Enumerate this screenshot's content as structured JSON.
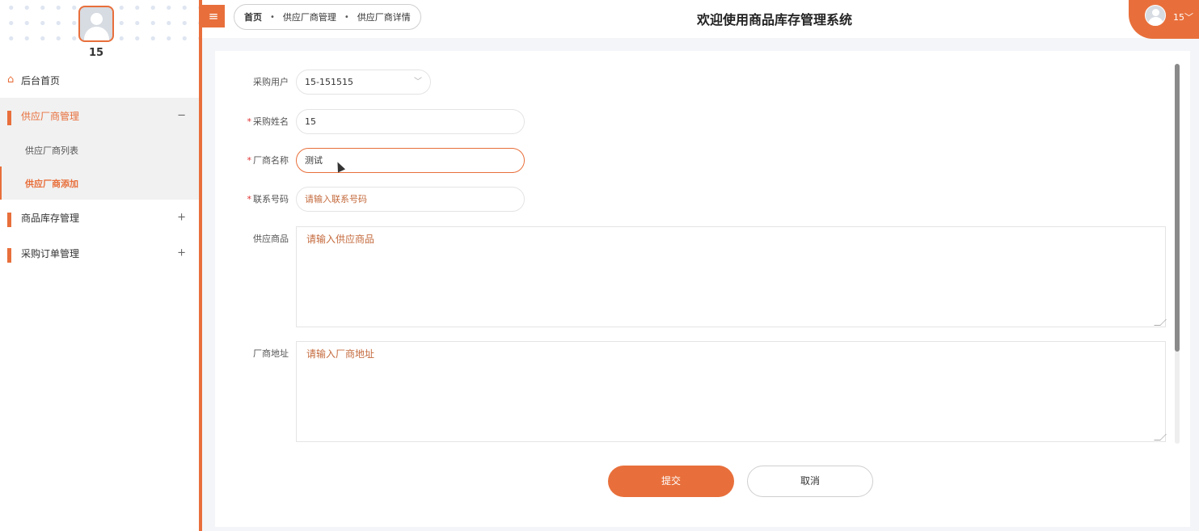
{
  "sidebar": {
    "user_name": "15",
    "menu": {
      "home": {
        "label": "后台首页"
      },
      "supplier": {
        "label": "供应厂商管理",
        "sign": "−"
      },
      "supplier_list": {
        "label": "供应厂商列表"
      },
      "supplier_add": {
        "label": "供应厂商添加"
      },
      "inventory": {
        "label": "商品库存管理",
        "sign": "+"
      },
      "orders": {
        "label": "采购订单管理",
        "sign": "+"
      }
    }
  },
  "header": {
    "toggle_icon": "≡",
    "breadcrumb": [
      "首页",
      "供应厂商管理",
      "供应厂商详情"
    ],
    "breadcrumb_sep": "•",
    "title": "欢迎使用商品库存管理系统",
    "user": "15"
  },
  "form": {
    "purchase_user": {
      "label": "采购用户",
      "value": "15-151515",
      "arrow": "﹀"
    },
    "purchase_name": {
      "label": "采购姓名",
      "value": "15",
      "required": "*"
    },
    "vendor_name": {
      "label": "厂商名称",
      "value": "测试",
      "required": "*"
    },
    "contact": {
      "label": "联系号码",
      "placeholder": "请输入联系号码",
      "required": "*"
    },
    "goods": {
      "label": "供应商品",
      "placeholder": "请输入供应商品"
    },
    "address": {
      "label": "厂商地址",
      "placeholder": "请输入厂商地址"
    },
    "submit": "提交",
    "cancel": "取消"
  },
  "colors": {
    "accent": "#e86f3b"
  }
}
